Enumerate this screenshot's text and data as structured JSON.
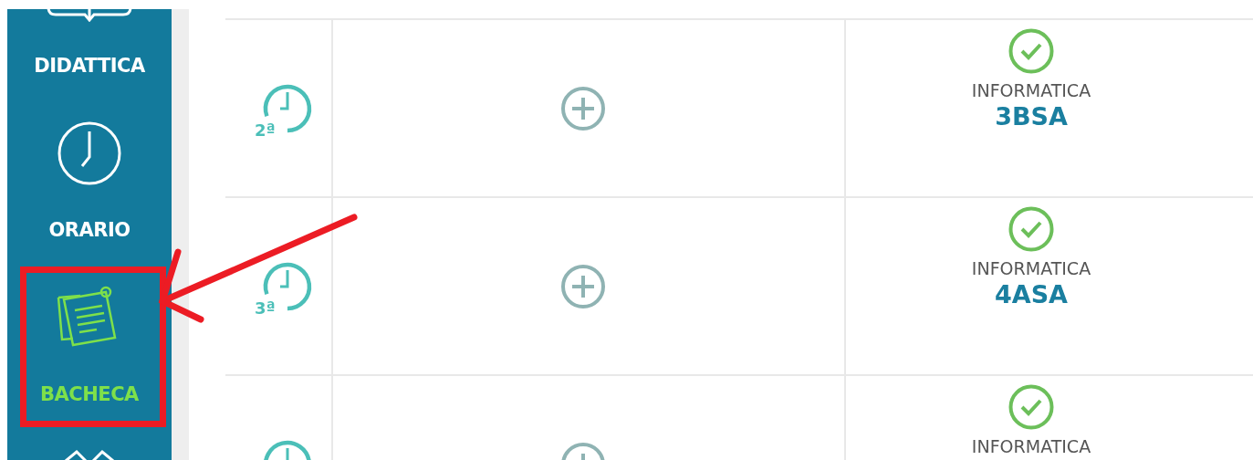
{
  "sidebar": {
    "items": [
      {
        "label": "DIDATTICA",
        "selected": false
      },
      {
        "label": "ORARIO",
        "selected": false
      },
      {
        "label": "BACHECA",
        "selected": true
      }
    ]
  },
  "table": {
    "rows": [
      {
        "hour": "2ª",
        "signed": true,
        "subject": "INFORMATICA",
        "class": "3BSA"
      },
      {
        "hour": "3ª",
        "signed": true,
        "subject": "INFORMATICA",
        "class": "4ASA"
      },
      {
        "signed": true,
        "subject": "INFORMATICA"
      }
    ]
  },
  "annotation": {
    "kind": "arrow-box"
  }
}
